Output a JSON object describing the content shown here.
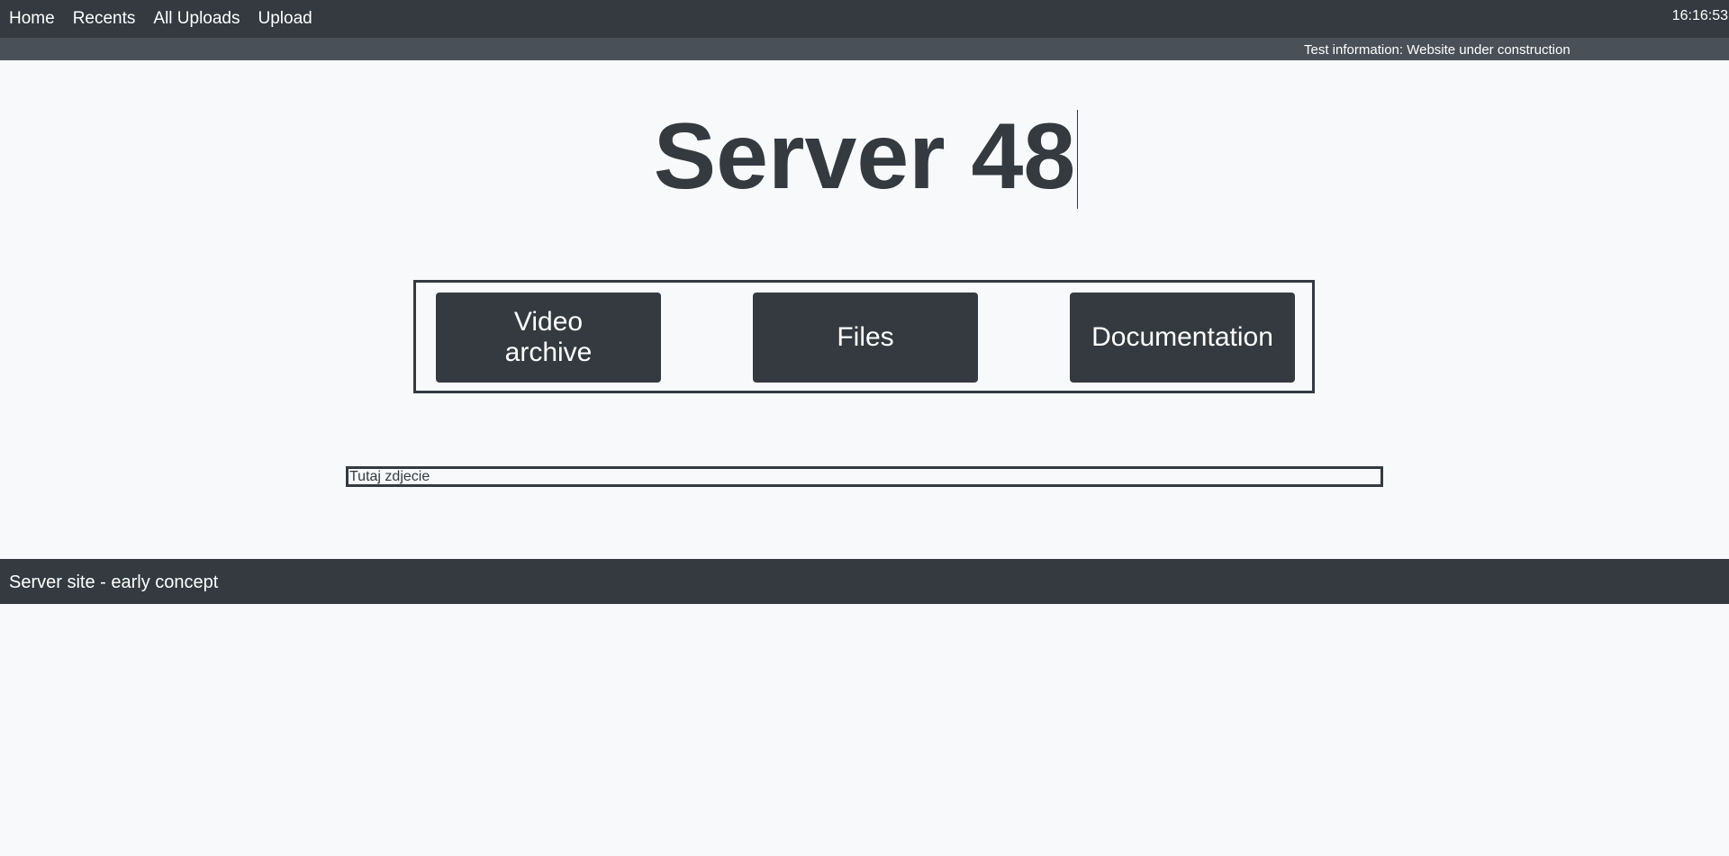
{
  "nav": {
    "items": [
      {
        "label": "Home"
      },
      {
        "label": "Recents"
      },
      {
        "label": "All Uploads"
      },
      {
        "label": "Upload"
      }
    ],
    "clock": "16:16:53"
  },
  "info_bar": {
    "text": "Test information: Website under construction"
  },
  "main": {
    "title": "Server 48",
    "buttons": [
      {
        "label": "Video archive"
      },
      {
        "label": "Files"
      },
      {
        "label": "Documentation"
      }
    ],
    "photo_placeholder": "Tutaj zdjecie"
  },
  "footer": {
    "text": "Server site - early concept"
  },
  "colors": {
    "dark": "#343a40",
    "info_bar": "#495057",
    "background": "#f8f9fa"
  }
}
